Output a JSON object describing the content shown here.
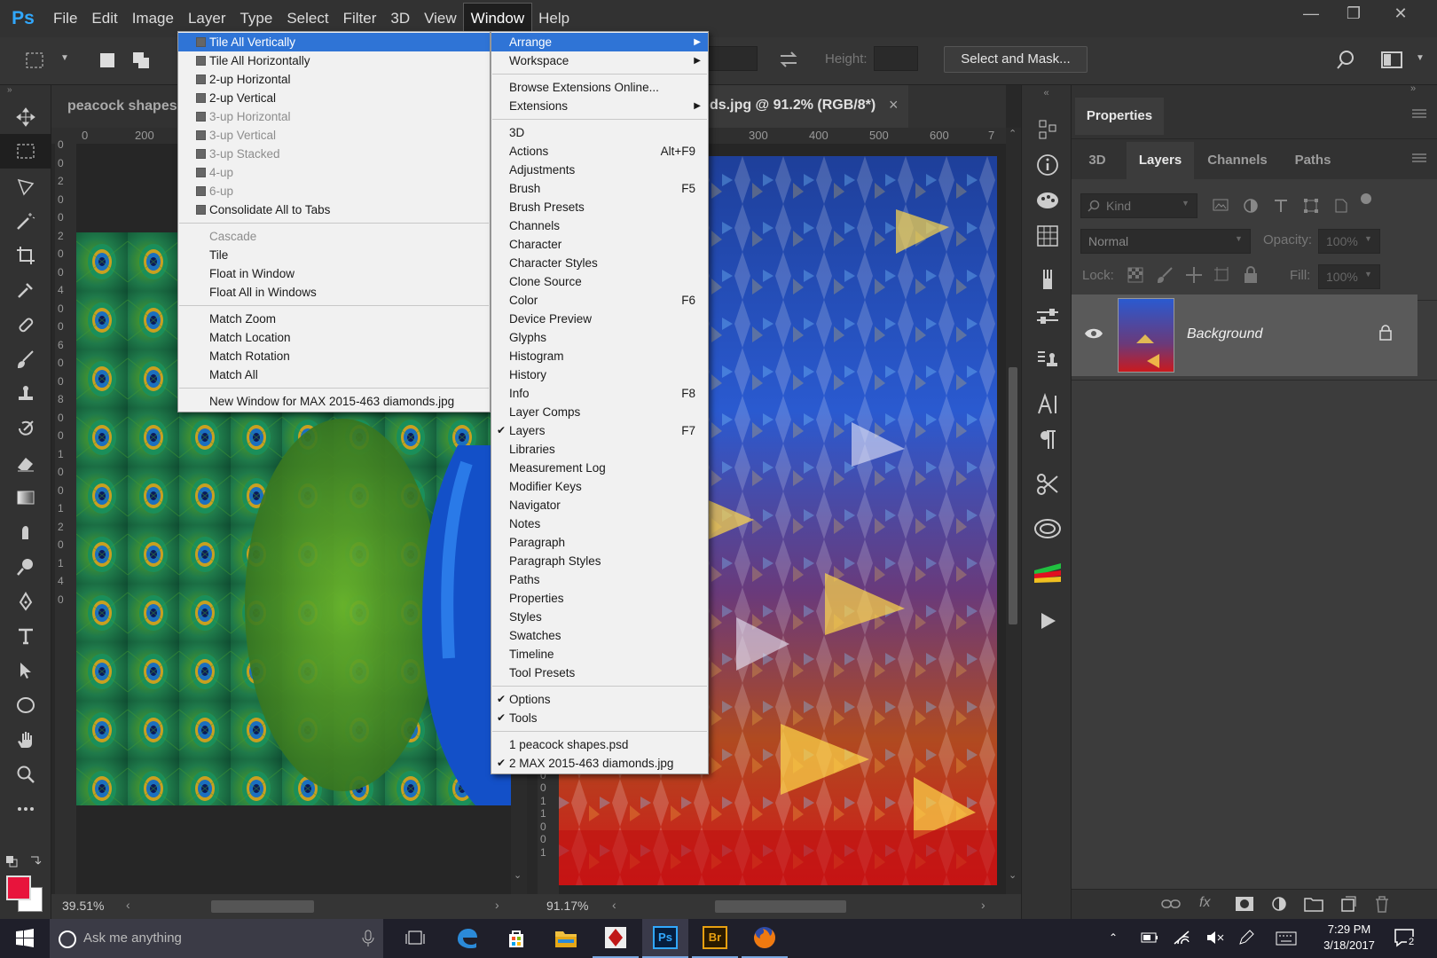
{
  "app": {
    "logo": "Ps"
  },
  "menubar": {
    "items": [
      "File",
      "Edit",
      "Image",
      "Layer",
      "Type",
      "Select",
      "Filter",
      "3D",
      "View",
      "Window",
      "Help"
    ],
    "active": "Window"
  },
  "window_controls": {
    "minimize": "—",
    "restore": "❐",
    "close": "✕"
  },
  "optbar": {
    "height_label": "Height:",
    "select_mask": "Select and Mask..."
  },
  "doc_left": {
    "tab": "peacock shapes.",
    "ruler_h": [
      "0",
      "200"
    ],
    "ruler_v": [
      "0",
      "0",
      "2",
      "0",
      "0",
      "2",
      "0",
      "0",
      "4",
      "0",
      "0",
      "6",
      "0",
      "0",
      "8",
      "0",
      "0",
      "1",
      "0",
      "0",
      "1",
      "2",
      "0",
      "1",
      "4",
      "0"
    ],
    "zoom": "39.51%"
  },
  "doc_right": {
    "tab": "ds.jpg @ 91.2% (RGB/8*)",
    "tab_close": "×",
    "ruler_h": [
      "300",
      "400",
      "500",
      "600",
      "7"
    ],
    "ruler_v": [
      "0",
      "0",
      "0",
      "1",
      "1",
      "0",
      "0",
      "1"
    ],
    "zoom": "91.17%"
  },
  "arrange_menu": {
    "items": [
      {
        "label": "Tile All Vertically",
        "state": "hl",
        "glyph": true
      },
      {
        "label": "Tile All Horizontally",
        "glyph": true
      },
      {
        "label": "2-up Horizontal",
        "glyph": true
      },
      {
        "label": "2-up Vertical",
        "glyph": true
      },
      {
        "label": "3-up Horizontal",
        "glyph": true,
        "state": "dis"
      },
      {
        "label": "3-up Vertical",
        "glyph": true,
        "state": "dis"
      },
      {
        "label": "3-up Stacked",
        "glyph": true,
        "state": "dis"
      },
      {
        "label": "4-up",
        "glyph": true,
        "state": "dis"
      },
      {
        "label": "6-up",
        "glyph": true,
        "state": "dis"
      },
      {
        "label": "Consolidate All to Tabs",
        "glyph": true
      },
      {
        "sep": true
      },
      {
        "label": "Cascade",
        "state": "dis"
      },
      {
        "label": "Tile"
      },
      {
        "label": "Float in Window"
      },
      {
        "label": "Float All in Windows"
      },
      {
        "sep": true
      },
      {
        "label": "Match Zoom"
      },
      {
        "label": "Match Location"
      },
      {
        "label": "Match Rotation"
      },
      {
        "label": "Match All"
      },
      {
        "sep": true
      },
      {
        "label": "New Window for MAX 2015-463 diamonds.jpg"
      }
    ]
  },
  "window_menu": {
    "items": [
      {
        "label": "Arrange",
        "state": "hl",
        "arrow": true
      },
      {
        "label": "Workspace",
        "arrow": true
      },
      {
        "sep": true
      },
      {
        "label": "Browse Extensions Online..."
      },
      {
        "label": "Extensions",
        "arrow": true
      },
      {
        "sep": true
      },
      {
        "label": "3D"
      },
      {
        "label": "Actions",
        "shortcut": "Alt+F9"
      },
      {
        "label": "Adjustments"
      },
      {
        "label": "Brush",
        "shortcut": "F5"
      },
      {
        "label": "Brush Presets"
      },
      {
        "label": "Channels"
      },
      {
        "label": "Character"
      },
      {
        "label": "Character Styles"
      },
      {
        "label": "Clone Source"
      },
      {
        "label": "Color",
        "shortcut": "F6"
      },
      {
        "label": "Device Preview"
      },
      {
        "label": "Glyphs"
      },
      {
        "label": "Histogram"
      },
      {
        "label": "History"
      },
      {
        "label": "Info",
        "shortcut": "F8"
      },
      {
        "label": "Layer Comps"
      },
      {
        "label": "Layers",
        "shortcut": "F7",
        "checked": true
      },
      {
        "label": "Libraries"
      },
      {
        "label": "Measurement Log"
      },
      {
        "label": "Modifier Keys"
      },
      {
        "label": "Navigator"
      },
      {
        "label": "Notes"
      },
      {
        "label": "Paragraph"
      },
      {
        "label": "Paragraph Styles"
      },
      {
        "label": "Paths"
      },
      {
        "label": "Properties"
      },
      {
        "label": "Styles"
      },
      {
        "label": "Swatches"
      },
      {
        "label": "Timeline"
      },
      {
        "label": "Tool Presets"
      },
      {
        "sep": true
      },
      {
        "label": "Options",
        "checked": true
      },
      {
        "label": "Tools",
        "checked": true
      },
      {
        "sep": true
      },
      {
        "label": "1 peacock shapes.psd"
      },
      {
        "label": "2 MAX 2015-463 diamonds.jpg",
        "checked": true
      }
    ]
  },
  "panels": {
    "properties_tab": "Properties",
    "tabs": [
      "3D",
      "Layers",
      "Channels",
      "Paths"
    ],
    "active_tab": "Layers",
    "kind_placeholder": "Kind",
    "blend_mode": "Normal",
    "opacity_label": "Opacity:",
    "opacity_value": "100%",
    "lock_label": "Lock:",
    "fill_label": "Fill:",
    "fill_value": "100%",
    "layer_name": "Background",
    "footer_fx": "fx"
  },
  "taskbar": {
    "search_placeholder": "Ask me anything",
    "time": "7:29 PM",
    "date": "3/18/2017",
    "notif_count": "2",
    "icons": [
      "task-view",
      "edge",
      "store",
      "file-explorer",
      "app-red",
      "photoshop",
      "bridge",
      "firefox"
    ],
    "ps_label": "Ps",
    "br_label": "Br"
  },
  "colors": {
    "accent": "#2f74d6",
    "fg_swatch": "#e8143c",
    "bg_swatch": "#ffffff",
    "ps_blue": "#31a8ff"
  }
}
